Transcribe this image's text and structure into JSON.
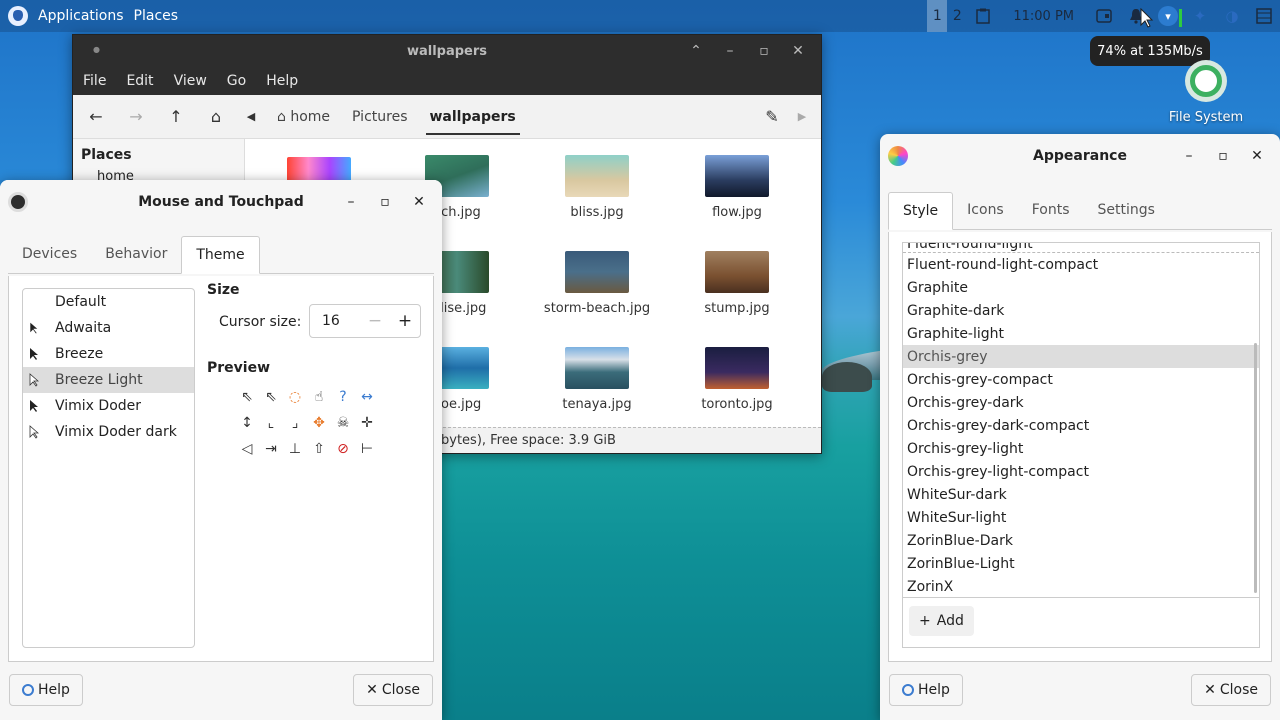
{
  "top_panel": {
    "applications": "Applications",
    "places": "Places",
    "workspaces": [
      "1",
      "2"
    ],
    "clock": "11:00 PM",
    "network_tooltip": "74% at 135Mb/s"
  },
  "desktop": {
    "icons": [
      {
        "label": "File System",
        "icon": "drive-icon"
      }
    ]
  },
  "file_manager": {
    "title": "wallpapers",
    "menu": [
      "File",
      "Edit",
      "View",
      "Go",
      "Help"
    ],
    "breadcrumbs": [
      "home",
      "Pictures",
      "wallpapers"
    ],
    "sidebar_title": "Places",
    "sidebar_items": [
      "home"
    ],
    "files": [
      {
        "name": "ach.jpg",
        "color": "#2f6e5a"
      },
      {
        "name": "bliss.jpg",
        "color": "#d9c8a0"
      },
      {
        "name": "flow.jpg",
        "color": "#2b3d60"
      },
      {
        "name": "adise.jpg",
        "color": "#3a5a34"
      },
      {
        "name": "storm-beach.jpg",
        "color": "#4a6f8a"
      },
      {
        "name": "stump.jpg",
        "color": "#7a5030"
      },
      {
        "name": "hoe.jpg",
        "color": "#1f6ea8"
      },
      {
        "name": "tenaya.jpg",
        "color": "#3a6c7a"
      },
      {
        "name": "toronto.jpg",
        "color": "#1a1e40"
      }
    ],
    "status": "bytes), Free space: 3.9 GiB"
  },
  "mouse": {
    "title": "Mouse and Touchpad",
    "tabs": [
      "Devices",
      "Behavior",
      "Theme"
    ],
    "active_tab": "Theme",
    "themes": [
      "Default",
      "Adwaita",
      "Breeze",
      "Breeze Light",
      "Vimix Doder",
      "Vimix Doder dark"
    ],
    "selected_theme": "Breeze Light",
    "size_heading": "Size",
    "cursor_size_label": "Cursor size:",
    "cursor_size_value": "16",
    "preview_heading": "Preview",
    "preview_icons": [
      "arrow-icon",
      "busy-arrow-icon",
      "spinner-icon",
      "hand-icon",
      "help-cursor-icon",
      "h-resize-icon",
      "v-resize-icon",
      "corner-resize-icon",
      "corner-resize2-icon",
      "move-icon",
      "pirate-icon",
      "crosshair-icon",
      "left-arrow-icon",
      "col-resize-icon",
      "bottom-edge-icon",
      "up-arrow-icon",
      "not-allowed-icon",
      "row-resize-icon"
    ],
    "help_label": "Help",
    "close_label": "Close"
  },
  "appearance": {
    "title": "Appearance",
    "tabs": [
      "Style",
      "Icons",
      "Fonts",
      "Settings"
    ],
    "active_tab": "Style",
    "clipped_item": "Fluent-round-light",
    "styles": [
      "Fluent-round-light-compact",
      "Graphite",
      "Graphite-dark",
      "Graphite-light",
      "Orchis-grey",
      "Orchis-grey-compact",
      "Orchis-grey-dark",
      "Orchis-grey-dark-compact",
      "Orchis-grey-light",
      "Orchis-grey-light-compact",
      "WhiteSur-dark",
      "WhiteSur-light",
      "ZorinBlue-Dark",
      "ZorinBlue-Light",
      "ZorinX"
    ],
    "selected_style": "Orchis-grey",
    "add_label": "Add",
    "help_label": "Help",
    "close_label": "Close"
  }
}
